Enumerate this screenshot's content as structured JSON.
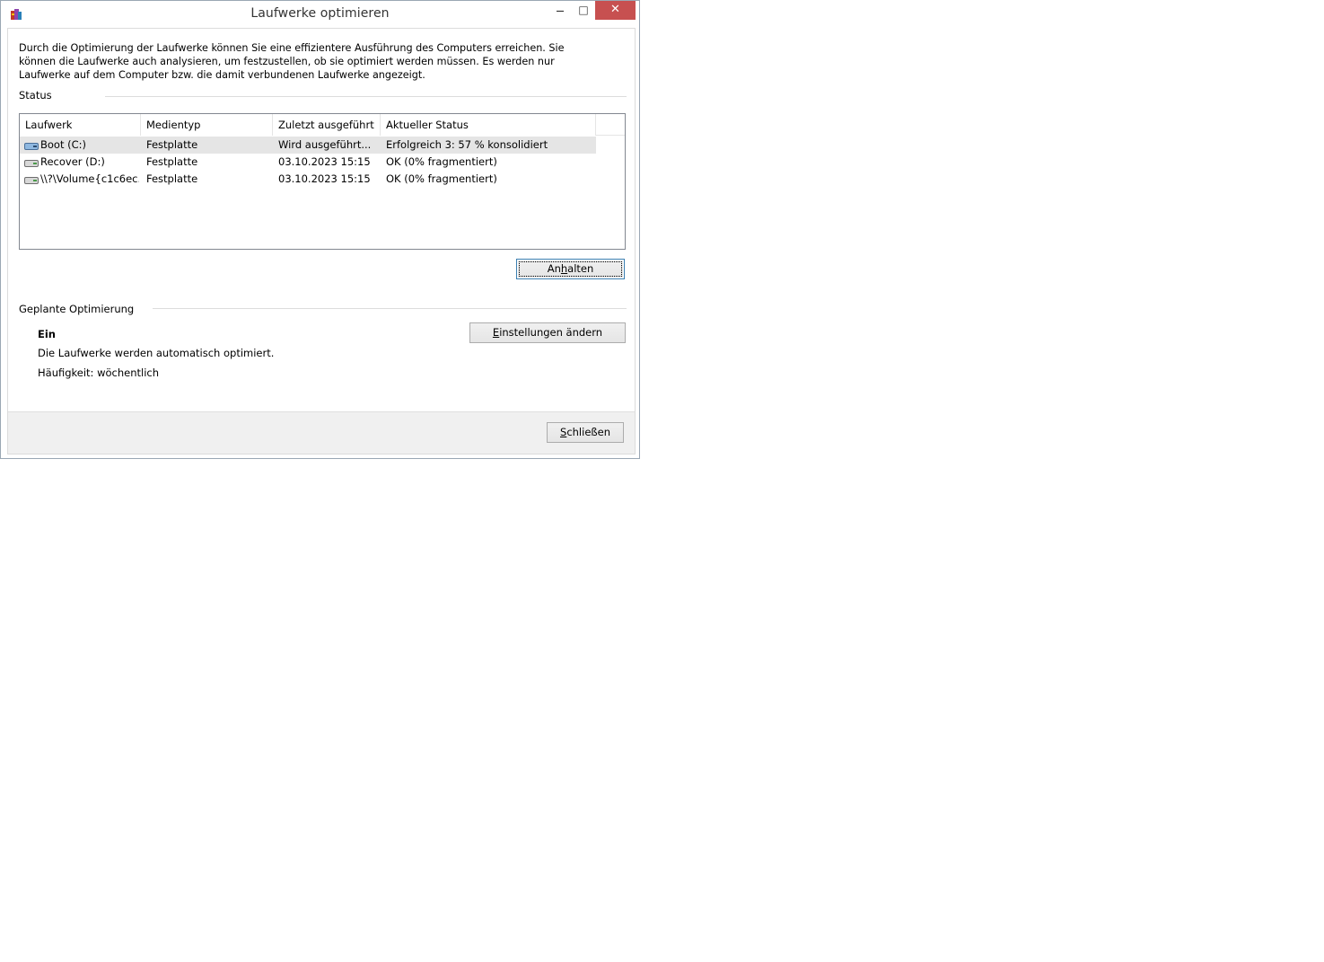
{
  "window": {
    "title": "Laufwerke optimieren",
    "minimize_glyph": "—",
    "maximize_glyph": "□",
    "close_glyph": "✕"
  },
  "description": "Durch die Optimierung der Laufwerke können Sie eine effizientere Ausführung des Computers erreichen. Sie können die Laufwerke auch analysieren, um festzustellen, ob sie optimiert werden müssen. Es werden nur Laufwerke auf dem Computer bzw. die damit verbundenen Laufwerke angezeigt.",
  "status_group": {
    "label": "Status"
  },
  "drive_list": {
    "columns": [
      "Laufwerk",
      "Medientyp",
      "Zuletzt ausgeführt",
      "Aktueller Status"
    ],
    "rows": [
      {
        "drive": "Boot (C:)",
        "media": "Festplatte",
        "last_run": "Wird ausgeführt...",
        "status": "Erfolgreich 3: 57 % konsolidiert",
        "icon": "system-drive-icon"
      },
      {
        "drive": "Recover (D:)",
        "media": "Festplatte",
        "last_run": "03.10.2023 15:15",
        "status": "OK (0% fragmentiert)",
        "icon": "hard-drive-icon"
      },
      {
        "drive": "\\\\?\\Volume{c1c6ec...",
        "media": "Festplatte",
        "last_run": "03.10.2023 15:15",
        "status": "OK (0% fragmentiert)",
        "icon": "hard-drive-icon"
      }
    ]
  },
  "buttons": {
    "stop": {
      "pre": "An",
      "accel": "h",
      "post": "alten"
    },
    "settings": {
      "pre": "",
      "accel": "E",
      "post": "instellungen ändern"
    },
    "close": {
      "pre": "",
      "accel": "S",
      "post": "chließen"
    }
  },
  "scheduled": {
    "label": "Geplante Optimierung",
    "state": "Ein",
    "line1": "Die Laufwerke werden automatisch optimiert.",
    "frequency": "Häufigkeit: wöchentlich"
  },
  "colors": {
    "close_button": "#c75050",
    "selected_row": "#e5e5e5",
    "footer": "#f0f0f0"
  }
}
